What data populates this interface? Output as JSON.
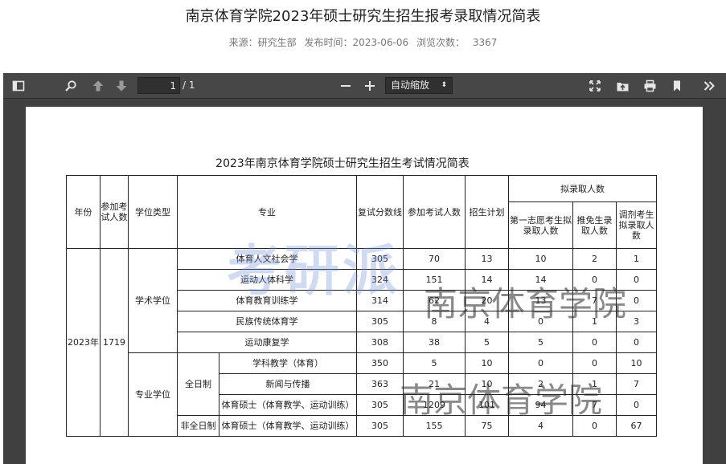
{
  "article": {
    "title": "南京体育学院2023年硕士研究生招生报考录取情况简表",
    "source_label": "来源：研究生部",
    "published_label": "发布时间：2023-06-06",
    "views_label": "浏览次数：",
    "views_count": "3367"
  },
  "viewer": {
    "page_current": "1",
    "page_total": "/ 1",
    "zoom_label": "自动缩放",
    "icons": [
      "sidebar-toggle-icon",
      "search-icon",
      "arrow-up-icon",
      "arrow-down-icon",
      "minus-icon",
      "plus-icon",
      "fullscreen-icon",
      "open-file-icon",
      "print-icon",
      "bookmark-icon",
      "double-chevron-right-icon"
    ]
  },
  "table": {
    "title": "2023年南京体育学院硕士研究生招生考试情况简表",
    "headers": {
      "year": "年份",
      "applicants": "参加考试人数",
      "degree_type": "学位类型",
      "major": "专业",
      "score_line": "复试分数线",
      "examinees": "参加考试人数",
      "plan": "招生计划",
      "admit_group": "拟录取人数",
      "first_choice": "第一志愿考生拟录取人数",
      "exempt": "推免生录取人数",
      "transfer": "调剂考生拟录取人数"
    },
    "year": "2023年",
    "applicants_total": "1719",
    "academic_label": "学术学位",
    "professional_label": "专业学位",
    "fulltime_label": "全日制",
    "parttime_label": "非全日制",
    "rows": [
      {
        "major": "体育人文社会学",
        "score": "305",
        "examinees": "70",
        "plan": "13",
        "first": "10",
        "exempt": "2",
        "transfer": "1"
      },
      {
        "major": "运动人体科学",
        "score": "324",
        "examinees": "151",
        "plan": "14",
        "first": "14",
        "exempt": "0",
        "transfer": "0"
      },
      {
        "major": "体育教育训练学",
        "score": "314",
        "examinees": "62",
        "plan": "20",
        "first": "13",
        "exempt": "7",
        "transfer": "0"
      },
      {
        "major": "民族传统体育学",
        "score": "305",
        "examinees": "8",
        "plan": "4",
        "first": "0",
        "exempt": "1",
        "transfer": "3"
      },
      {
        "major": "运动康复学",
        "score": "308",
        "examinees": "38",
        "plan": "5",
        "first": "5",
        "exempt": "0",
        "transfer": "0"
      },
      {
        "major": "学科教学（体育）",
        "score": "350",
        "examinees": "5",
        "plan": "10",
        "first": "0",
        "exempt": "0",
        "transfer": "10"
      },
      {
        "major": "新闻与传播",
        "score": "363",
        "examinees": "21",
        "plan": "10",
        "first": "2",
        "exempt": "1",
        "transfer": "7"
      },
      {
        "major": "体育硕士（体育教学、运动训练）",
        "score": "305",
        "examinees": "1209",
        "plan": "101",
        "first": "94",
        "exempt": "7",
        "transfer": "0"
      },
      {
        "major": "体育硕士（体育教学、运动训练）",
        "score": "305",
        "examinees": "155",
        "plan": "75",
        "first": "4",
        "exempt": "0",
        "transfer": "67"
      }
    ]
  },
  "watermarks": {
    "blue": "考研派",
    "gray_1": "南京体育学院",
    "gray_2": "南京体育学院"
  }
}
